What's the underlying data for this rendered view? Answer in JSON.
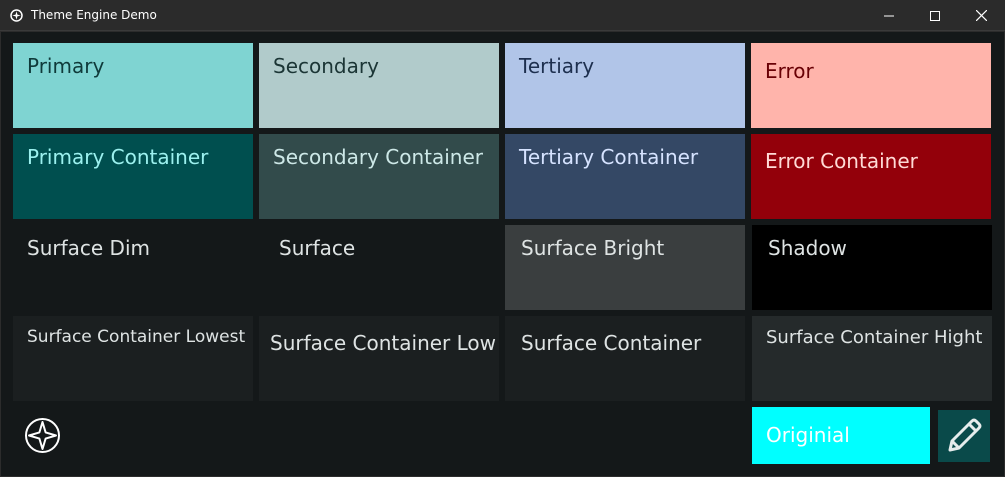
{
  "window": {
    "title": "Theme Engine Demo",
    "icon": "app-compass-icon",
    "controls": [
      "minimize-icon",
      "maximize-icon",
      "close-icon"
    ]
  },
  "tiles": [
    {
      "label": "Primary",
      "bg": "#7fd4d2",
      "fg": "#0f3a3a"
    },
    {
      "label": "Secondary",
      "bg": "#b1cbcb",
      "fg": "#1b3535"
    },
    {
      "label": "Tertiary",
      "bg": "#b1c5e8",
      "fg": "#1d2f4e"
    },
    {
      "label": "Error",
      "bg": "#ffb4ab",
      "fg": "#690005"
    },
    {
      "label": "Primary Container",
      "bg": "#004f4f",
      "fg": "#9cf1ef"
    },
    {
      "label": "Secondary Container",
      "bg": "#324b4b",
      "fg": "#cde8e7"
    },
    {
      "label": "Tertiary Container",
      "bg": "#344865",
      "fg": "#d6e3ff"
    },
    {
      "label": "Error Container",
      "bg": "#93000a",
      "fg": "#ffdad6"
    },
    {
      "label": "Surface Dim",
      "bg": "#141819",
      "fg": "#dee3e3"
    },
    {
      "label": "Surface",
      "bg": "#141819",
      "fg": "#dee3e3"
    },
    {
      "label": "Surface Bright",
      "bg": "#3a3e3f",
      "fg": "#dee3e3"
    },
    {
      "label": "Shadow",
      "bg": "#000000",
      "fg": "#dee3e3"
    },
    {
      "label": "Surface Container Lowest",
      "bg": "#1b1f20",
      "fg": "#dee3e3"
    },
    {
      "label": "Surface Container Low",
      "bg": "#1b1f20",
      "fg": "#dee3e3"
    },
    {
      "label": "Surface Container",
      "bg": "#1b1f20",
      "fg": "#dee3e3"
    },
    {
      "label": "Surface Container Hight",
      "bg": "#252a2b",
      "fg": "#dee3e3"
    }
  ],
  "bottom": {
    "compass_icon": "compass-star-icon",
    "original_label": "Originial",
    "original_bg": "#00ffff",
    "edit_icon": "pencil-icon",
    "edit_bg": "#0a4a4a"
  }
}
